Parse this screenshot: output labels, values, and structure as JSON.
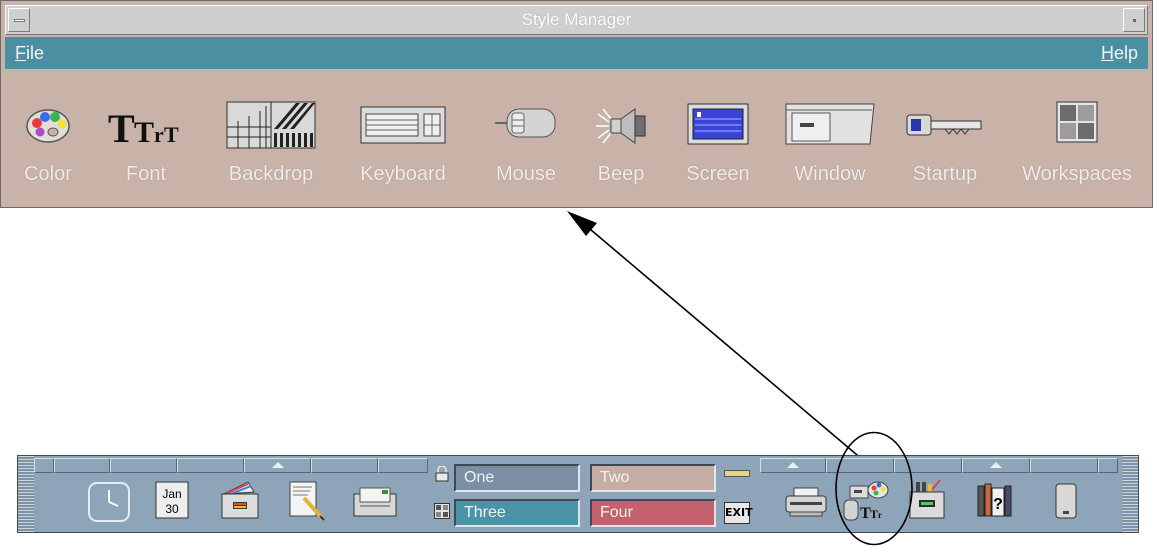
{
  "style_manager": {
    "title": "Style Manager",
    "menus": {
      "file": {
        "mnemonic": "F",
        "rest": "ile"
      },
      "help": {
        "mnemonic": "H",
        "rest": "elp"
      }
    },
    "icons": [
      {
        "key": "color",
        "label": "Color",
        "icon": "palette-icon"
      },
      {
        "key": "font",
        "label": "Font",
        "icon": "font-icon",
        "glyph": "TTT"
      },
      {
        "key": "backdrop",
        "label": "Backdrop",
        "icon": "backdrop-icon"
      },
      {
        "key": "keyboard",
        "label": "Keyboard",
        "icon": "keyboard-icon"
      },
      {
        "key": "mouse",
        "label": "Mouse",
        "icon": "mouse-icon"
      },
      {
        "key": "beep",
        "label": "Beep",
        "icon": "speaker-icon"
      },
      {
        "key": "screen",
        "label": "Screen",
        "icon": "screen-icon"
      },
      {
        "key": "window",
        "label": "Window",
        "icon": "window-icon"
      },
      {
        "key": "startup",
        "label": "Startup",
        "icon": "key-icon"
      },
      {
        "key": "workspaces",
        "label": "Workspaces",
        "icon": "workspaces-icon"
      }
    ]
  },
  "front_panel": {
    "calendar": {
      "month": "Jan",
      "day": "30"
    },
    "workspaces": {
      "one": "One",
      "two": "Two",
      "three": "Three",
      "four": "Four"
    },
    "exit_label": "EXIT",
    "icons": [
      "clock-icon",
      "calendar-icon",
      "file-manager-icon",
      "text-editor-icon",
      "mailer-icon",
      "printer-icon",
      "style-manager-icon",
      "application-manager-icon",
      "help-manager-icon",
      "trash-icon"
    ]
  },
  "colors": {
    "window_bg": "#c9b2a8",
    "menubar_bg": "#4b8fa3",
    "front_panel_bg": "#8ea4b8"
  }
}
